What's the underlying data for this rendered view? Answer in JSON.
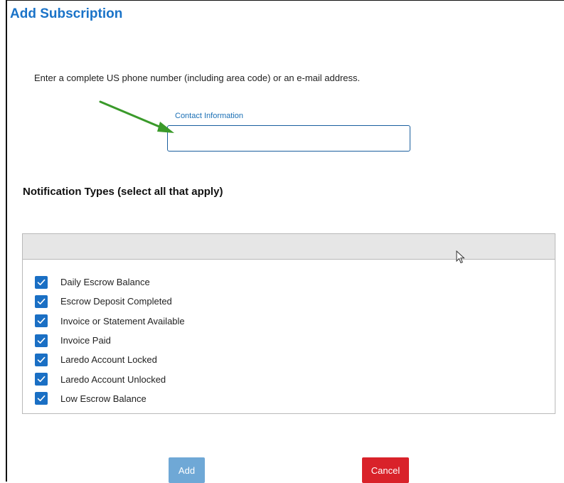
{
  "dialog": {
    "title": "Add Subscription",
    "instructions": "Enter a complete US phone number (including area code) or an e-mail address."
  },
  "contact": {
    "label": "Contact Information",
    "value": "",
    "placeholder": ""
  },
  "notification_types": {
    "heading": "Notification Types (select all that apply)",
    "items": [
      {
        "label": "Daily Escrow Balance",
        "checked": true
      },
      {
        "label": "Escrow Deposit Completed",
        "checked": true
      },
      {
        "label": "Invoice or Statement Available",
        "checked": true
      },
      {
        "label": "Invoice Paid",
        "checked": true
      },
      {
        "label": "Laredo Account Locked",
        "checked": true
      },
      {
        "label": "Laredo Account Unlocked",
        "checked": true
      },
      {
        "label": "Low Escrow Balance",
        "checked": true
      }
    ]
  },
  "buttons": {
    "add_label": "Add",
    "cancel_label": "Cancel"
  },
  "colors": {
    "accent": "#1a73c8",
    "checkbox": "#1a6fc4",
    "add_button": "#6fa8d6",
    "cancel_button": "#d9222a",
    "annotation_arrow": "#3a9a2a"
  },
  "icons": {
    "checkmark": "check-icon",
    "annotation": "green-arrow-icon",
    "pointer": "mouse-cursor-icon"
  }
}
